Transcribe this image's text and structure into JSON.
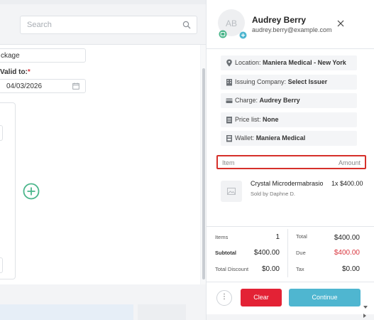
{
  "left": {
    "search_placeholder": "Search",
    "package_value": "ckage",
    "valid_to_label": "Valid to:",
    "valid_to_required": "*",
    "valid_to_value": "04/03/2026"
  },
  "customer": {
    "initials": "AB",
    "name": "Audrey Berry",
    "email": "audrey.berry@example.com"
  },
  "info": {
    "location_label": "Location:",
    "location_value": "Maniera Medical - New York",
    "issuing_label": "Issuing Company:",
    "issuing_value": "Select Issuer",
    "charge_label": "Charge:",
    "charge_value": "Audrey Berry",
    "price_list_label": "Price list:",
    "price_list_value": "None",
    "wallet_label": "Wallet:",
    "wallet_value": "Maniera Medical"
  },
  "items_table": {
    "col_item": "Item",
    "col_amount": "Amount"
  },
  "line_item": {
    "name": "Crystal Microdermabrasion",
    "qty_amount": "1x $400.00",
    "sold_by": "Sold by Daphne D."
  },
  "totals": {
    "items_label": "Items",
    "items_value": "1",
    "subtotal_label": "Subtotal",
    "subtotal_value": "$400.00",
    "total_discount_label": "Total Discount",
    "total_discount_value": "$0.00",
    "total_label": "Total",
    "total_value": "$400.00",
    "due_label": "Due",
    "due_value": "$400.00",
    "tax_label": "Tax",
    "tax_value": "$0.00"
  },
  "actions": {
    "more_label": "⋮",
    "clear_label": "Clear",
    "continue_label": "Continue"
  },
  "colors": {
    "danger": "#e32235",
    "primary": "#4fb6d0",
    "highlight_border": "#d6302a",
    "add_icon": "#4cb68c",
    "due_value": "#d9363e"
  },
  "icons": [
    "search-icon",
    "calendar-icon",
    "add-circle-icon",
    "close-icon",
    "location-pin-icon",
    "building-icon",
    "card-icon",
    "list-icon",
    "wallet-icon",
    "image-placeholder-icon",
    "more-vertical-icon"
  ]
}
